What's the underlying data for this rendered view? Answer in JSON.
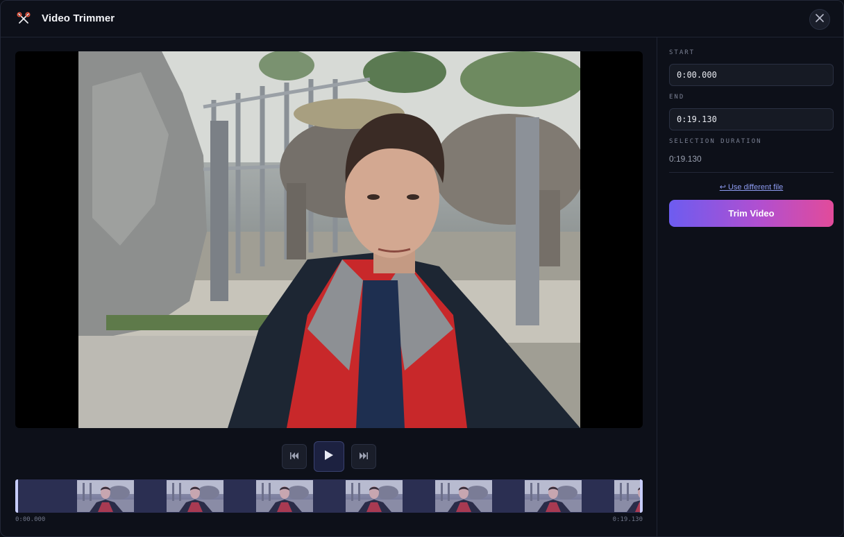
{
  "header": {
    "title": "Video Trimmer",
    "logo_icon": "scissors-icon",
    "close_icon": "close-icon"
  },
  "player": {
    "controls": [
      {
        "name": "skip-back-button",
        "icon": "skip-back-icon"
      },
      {
        "name": "play-button",
        "icon": "play-icon"
      },
      {
        "name": "skip-forward-button",
        "icon": "skip-forward-icon"
      }
    ]
  },
  "timeline": {
    "start_label": "0:00.000",
    "end_label": "0:19.130",
    "thumbnail_count": 7
  },
  "side": {
    "start_label": "START",
    "start_value": "0:00.000",
    "end_label": "END",
    "end_value": "0:19.130",
    "duration_label": "SELECTION DURATION",
    "duration_value": "0:19.130",
    "change_file_link": "↩ Use different file",
    "trim_button": "Trim Video"
  },
  "colors": {
    "accent_start": "#6d5cf0",
    "accent_end": "#e24b9a",
    "link": "#8e9cf2",
    "handle": "#c7cdfb"
  }
}
